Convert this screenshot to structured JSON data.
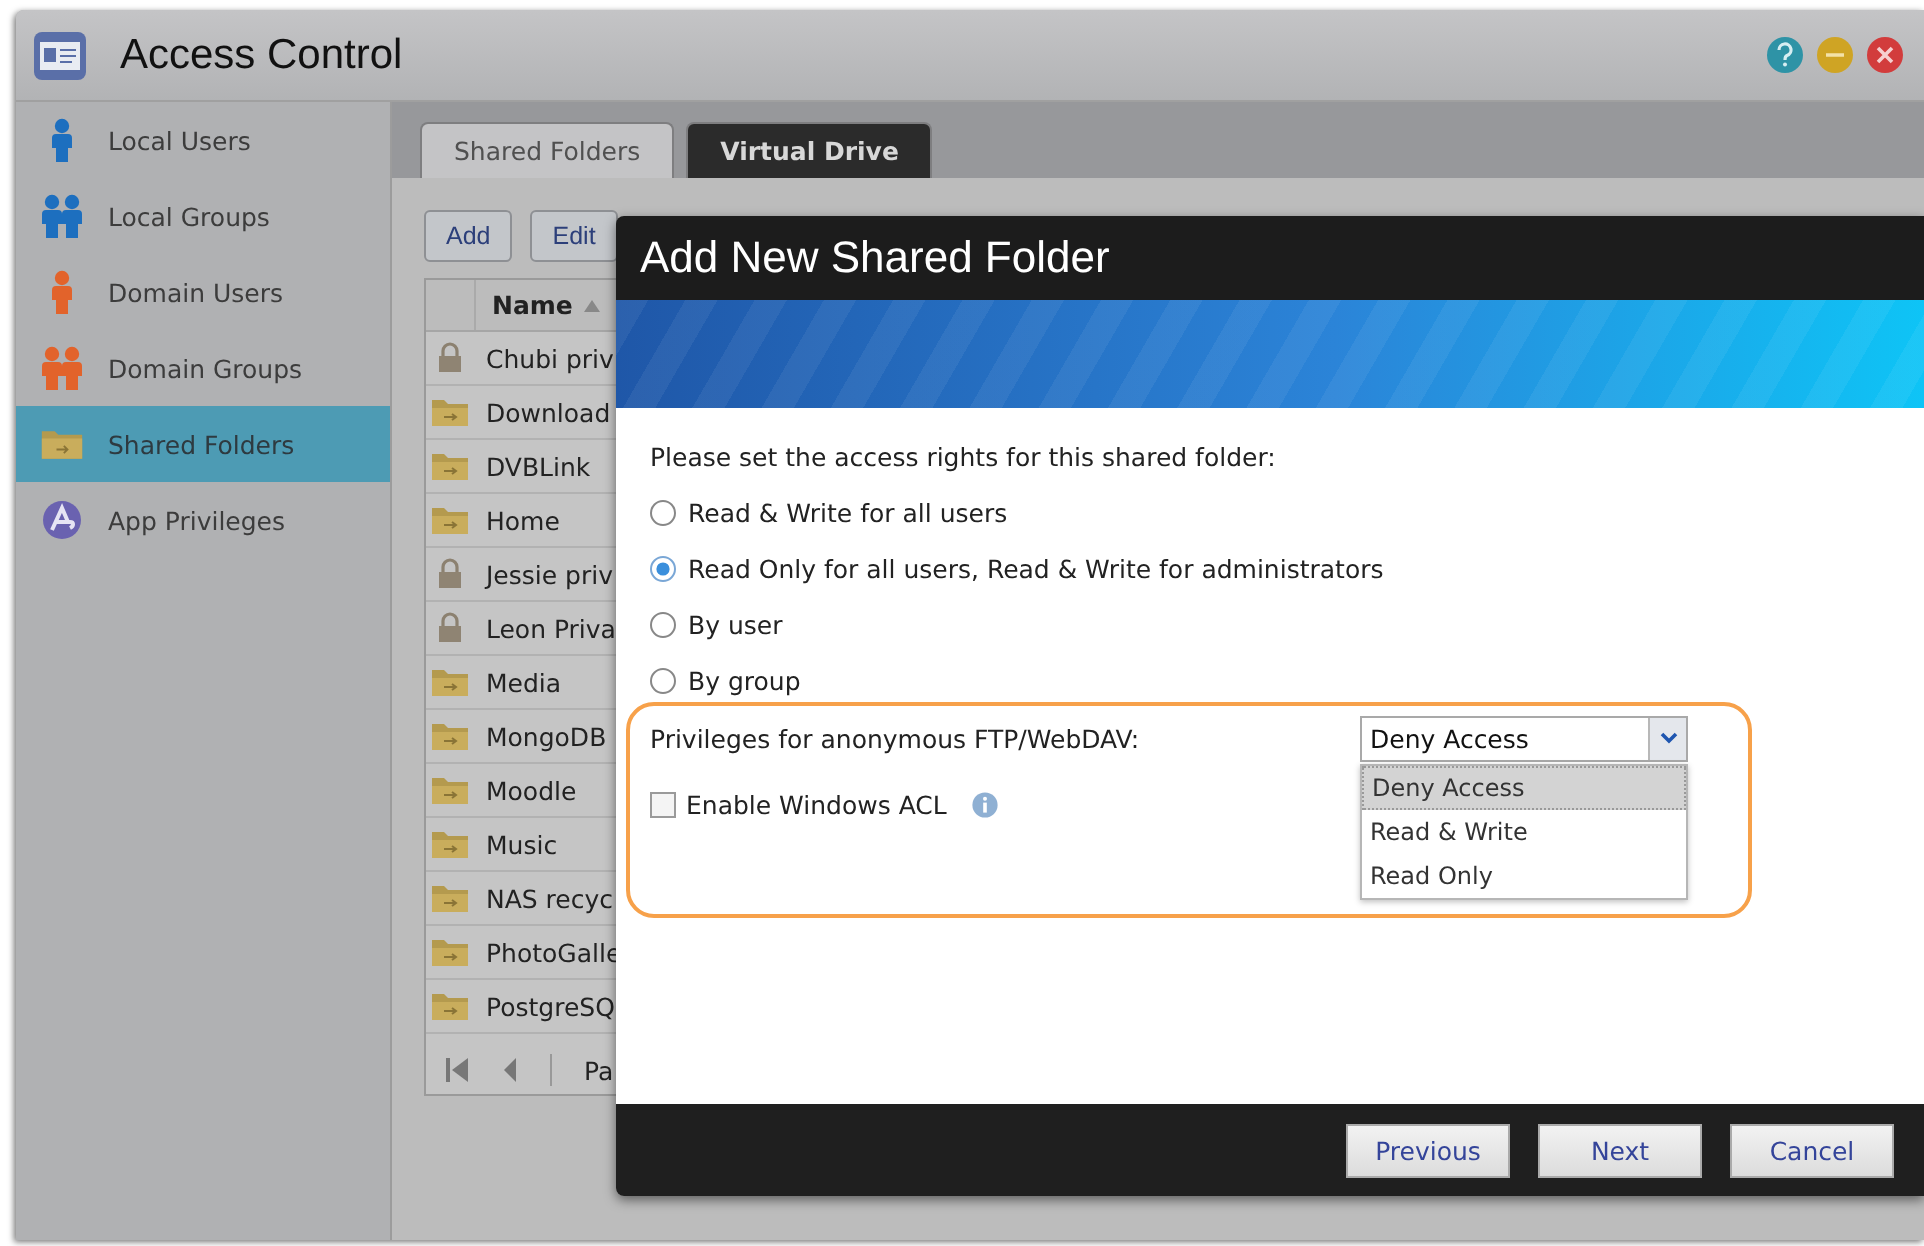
{
  "window": {
    "title": "Access Control"
  },
  "sidebar": {
    "items": [
      {
        "label": "Local Users",
        "kind": "user",
        "color": "#1d6fbf",
        "selected": false
      },
      {
        "label": "Local Groups",
        "kind": "group",
        "color": "#1d6fbf",
        "selected": false
      },
      {
        "label": "Domain Users",
        "kind": "user",
        "color": "#e2632b",
        "selected": false
      },
      {
        "label": "Domain Groups",
        "kind": "group",
        "color": "#e2632b",
        "selected": false
      },
      {
        "label": "Shared Folders",
        "kind": "folder",
        "selected": true
      },
      {
        "label": "App Privileges",
        "kind": "app",
        "selected": false
      }
    ]
  },
  "tabs": [
    {
      "label": "Shared Folders",
      "selected": true
    },
    {
      "label": "Virtual Drive",
      "selected": false
    }
  ],
  "toolbar": {
    "buttons": [
      "Add",
      "Edit"
    ]
  },
  "table": {
    "columns": [
      "Name"
    ],
    "rows": [
      {
        "name": "Chubi priv",
        "kind": "locked"
      },
      {
        "name": "Download",
        "kind": "folder"
      },
      {
        "name": "DVBLink",
        "kind": "folder"
      },
      {
        "name": "Home",
        "kind": "folder"
      },
      {
        "name": "Jessie priv",
        "kind": "locked"
      },
      {
        "name": "Leon Priva",
        "kind": "locked"
      },
      {
        "name": "Media",
        "kind": "folder"
      },
      {
        "name": "MongoDB",
        "kind": "folder"
      },
      {
        "name": "Moodle",
        "kind": "folder"
      },
      {
        "name": "Music",
        "kind": "folder"
      },
      {
        "name": "NAS recyc",
        "kind": "folder"
      },
      {
        "name": "PhotoGalle",
        "kind": "folder"
      },
      {
        "name": "PostgreSQ",
        "kind": "folder"
      }
    ],
    "pager": "Pa"
  },
  "dialog": {
    "title": "Add New Shared Folder",
    "prompt": "Please set the access rights for this shared folder:",
    "access_options": [
      {
        "label": "Read & Write for all users",
        "selected": false
      },
      {
        "label": "Read Only for all users, Read & Write for administrators",
        "selected": true
      },
      {
        "label": "By user",
        "selected": false
      },
      {
        "label": "By group",
        "selected": false
      }
    ],
    "anonymous_access": {
      "label": "Privileges for anonymous FTP/WebDAV:",
      "value": "Deny Access",
      "expanded": true,
      "options": [
        {
          "label": "Deny Access",
          "selected": true
        },
        {
          "label": "Read & Write",
          "selected": false
        },
        {
          "label": "Read Only",
          "selected": false
        }
      ]
    },
    "windows_acl": {
      "label": "Enable Windows ACL",
      "checked": false
    },
    "buttons": [
      "Previous",
      "Next",
      "Cancel"
    ]
  }
}
